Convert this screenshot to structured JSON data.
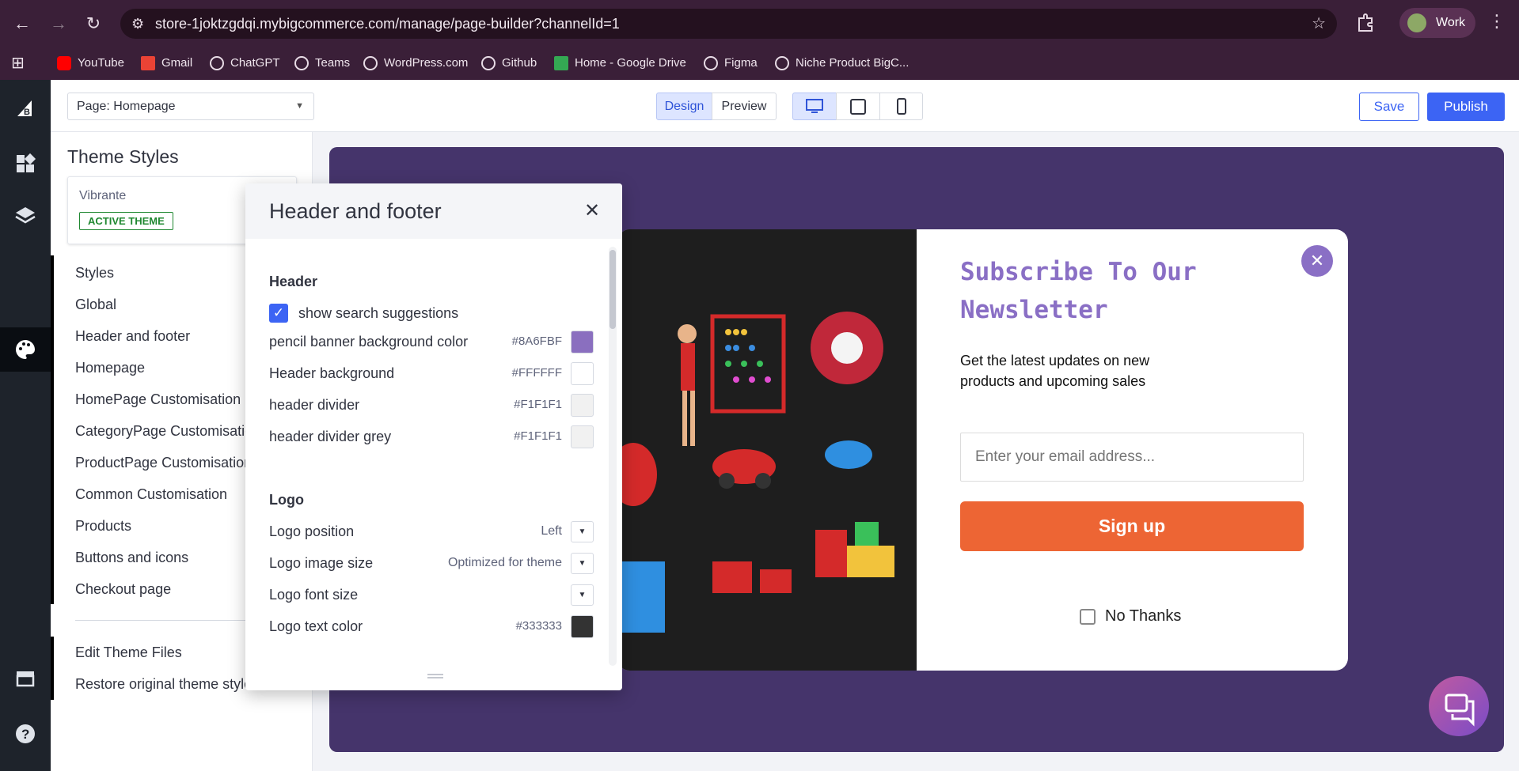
{
  "browser": {
    "url": "store-1joktzgdqi.mybigcommerce.com/manage/page-builder?channelId=1",
    "profile_label": "Work",
    "bookmarks": [
      {
        "label": "YouTube",
        "color": "#ff0000"
      },
      {
        "label": "Gmail",
        "color": "#ea4335"
      },
      {
        "label": "ChatGPT",
        "color": "#e8dce6"
      },
      {
        "label": "Teams",
        "color": "#e8dce6"
      },
      {
        "label": "WordPress.com",
        "color": "#e8dce6"
      },
      {
        "label": "Github",
        "color": "#e8dce6"
      },
      {
        "label": "Home - Google Drive",
        "color": "#34a853"
      },
      {
        "label": "Figma",
        "color": "#e8dce6"
      },
      {
        "label": "Niche Product BigC...",
        "color": "#e8dce6"
      }
    ]
  },
  "toolbar": {
    "page_select": "Page: Homepage",
    "design_label": "Design",
    "preview_label": "Preview",
    "save_label": "Save",
    "publish_label": "Publish",
    "accent_color": "#3c64f4"
  },
  "theme_panel": {
    "title": "Theme Styles",
    "theme_name": "Vibrante",
    "active_badge": "ACTIVE THEME",
    "nav_items": [
      "Styles",
      "Global",
      "Header and footer",
      "Homepage",
      "HomePage Customisation",
      "CategoryPage Customisation",
      "ProductPage Customisation",
      "Common Customisation",
      "Products",
      "Buttons and icons",
      "Checkout page"
    ],
    "footer_items": [
      "Edit Theme Files",
      "Restore original theme styles"
    ]
  },
  "header_footer_panel": {
    "title": "Header and footer",
    "header_section": "Header",
    "show_search_suggestions": "show search suggestions",
    "color_rows": [
      {
        "label": "pencil banner background color",
        "hex": "#8A6FBF"
      },
      {
        "label": "Header background",
        "hex": "#FFFFFF"
      },
      {
        "label": "header divider",
        "hex": "#F1F1F1"
      },
      {
        "label": "header divider grey",
        "hex": "#F1F1F1"
      }
    ],
    "logo_section": "Logo",
    "logo_rows": [
      {
        "label": "Logo position",
        "value": "Left"
      },
      {
        "label": "Logo image size",
        "value": "Optimized for theme"
      },
      {
        "label": "Logo font size",
        "value": ""
      }
    ],
    "logo_text_color": {
      "label": "Logo text color",
      "hex": "#333333"
    }
  },
  "popup": {
    "title": "Subscribe To Our Newsletter",
    "description": "Get the latest updates on new products and upcoming sales",
    "email_placeholder": "Enter your email address...",
    "signup_label": "Sign up",
    "no_thanks_label": "No Thanks",
    "title_color": "#8a6fc5",
    "button_color": "#ed6534"
  }
}
